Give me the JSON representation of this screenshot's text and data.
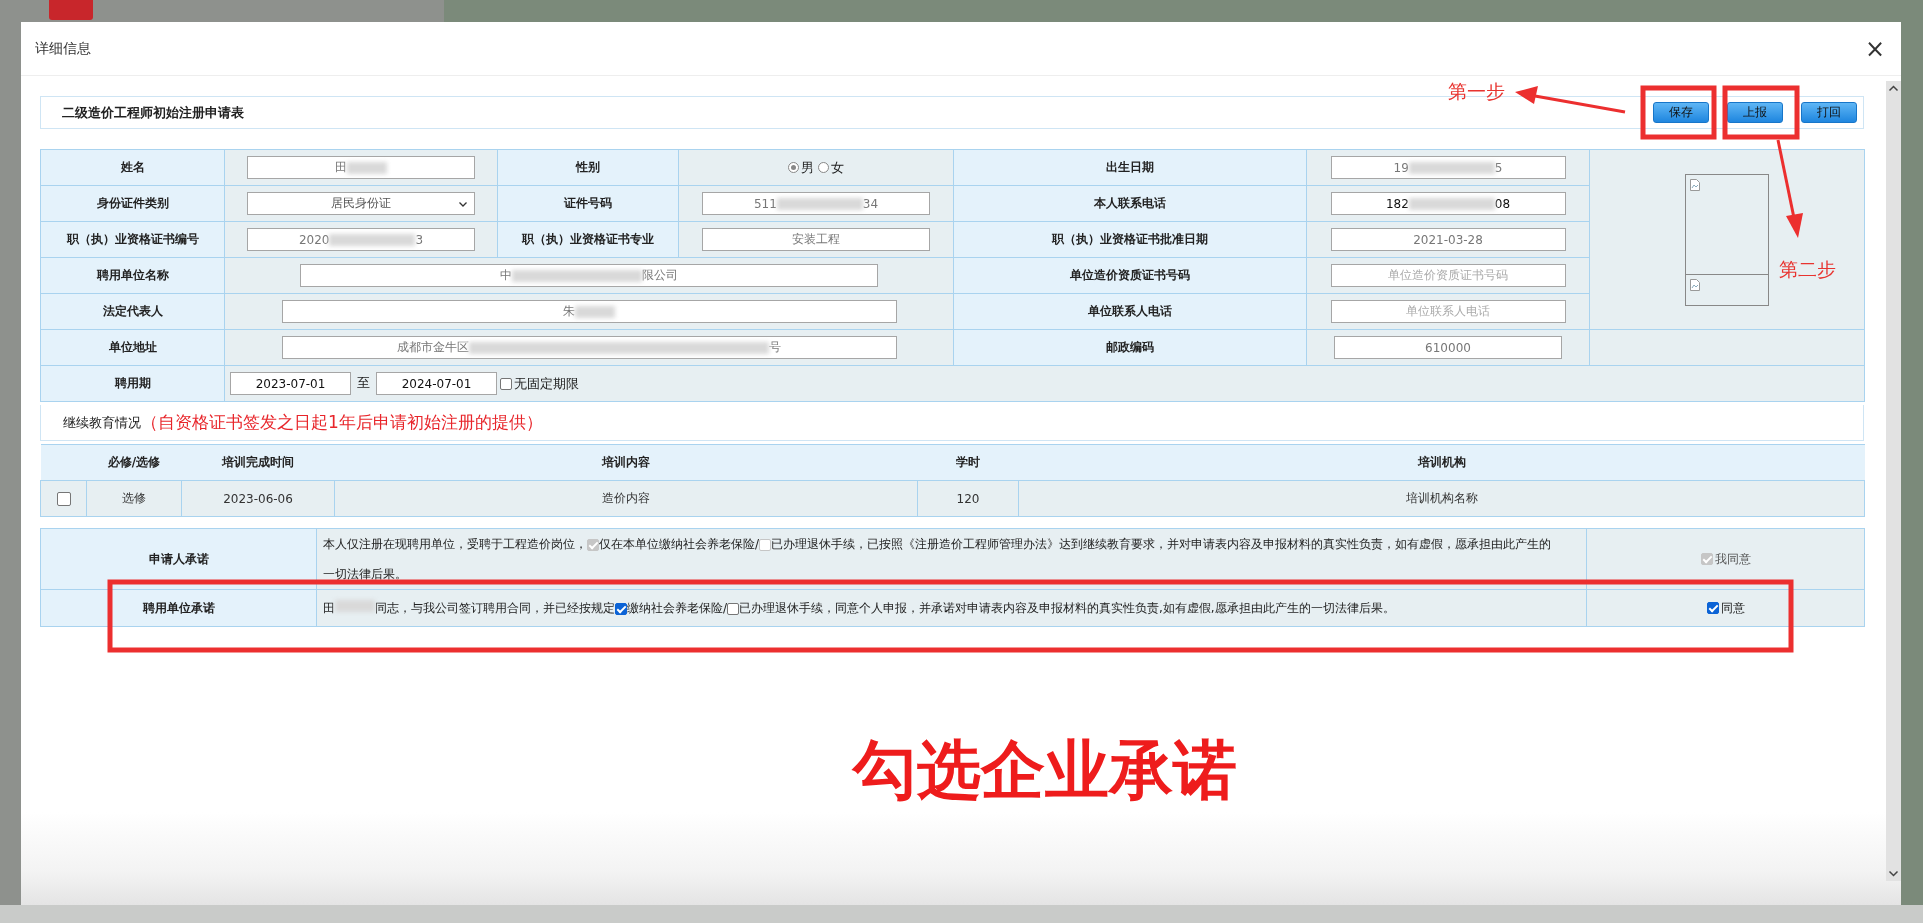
{
  "dialog": {
    "title": "详细信息",
    "close": "×"
  },
  "form": {
    "title": "二级造价工程师初始注册申请表",
    "buttons": [
      {
        "label": "保存"
      },
      {
        "label": "上报"
      },
      {
        "label": "打回"
      }
    ]
  },
  "fields": [
    {
      "cells": [
        {
          "label": "姓名",
          "kind": "masked",
          "prefix": "田",
          "editable": false
        },
        {
          "label": "性别",
          "kind": "radio",
          "options": [
            {
              "label": "男",
              "selected": true
            },
            {
              "label": "女",
              "selected": false
            }
          ]
        },
        {
          "label": "出生日期",
          "kind": "masked",
          "prefix": "19",
          "suffix": "5",
          "editable": false
        }
      ]
    },
    {
      "cells": [
        {
          "label": "身份证件类别",
          "kind": "select",
          "value": "居民身份证"
        },
        {
          "label": "证件号码",
          "kind": "masked",
          "prefix": "511",
          "suffix": "34",
          "editable": false
        },
        {
          "label": "本人联系电话",
          "kind": "masked",
          "prefix": "182",
          "suffix": "08",
          "editable": true
        }
      ]
    },
    {
      "cells": [
        {
          "label": "职（执）业资格证书编号",
          "kind": "masked",
          "prefix": "2020",
          "suffix": "3",
          "editable": false
        },
        {
          "label": "职（执）业资格证书专业",
          "kind": "text",
          "value": "安装工程",
          "editable": false
        },
        {
          "label": "职（执）业资格证书批准日期",
          "kind": "text",
          "value": "2021-03-28",
          "editable": false
        }
      ]
    },
    {
      "cells": [
        {
          "label": "聘用单位名称",
          "kind": "masked",
          "prefix": "中",
          "suffix": "限公司",
          "editable": false
        },
        {
          "label": "单位造价资质证书号码",
          "kind": "placeholder",
          "placeholder": "单位造价资质证书号码"
        }
      ]
    },
    {
      "cells": [
        {
          "label": "法定代表人",
          "kind": "masked",
          "prefix": "朱",
          "editable": false
        },
        {
          "label": "单位联系人电话",
          "kind": "placeholder",
          "placeholder": "单位联系人电话"
        }
      ]
    },
    {
      "cells": [
        {
          "label": "单位地址",
          "kind": "masked",
          "prefix": "成都市金牛区",
          "suffix": "号",
          "editable": false
        },
        {
          "label": "邮政编码",
          "kind": "text",
          "value": "610000",
          "editable": false
        }
      ]
    }
  ],
  "employment_period": {
    "label": "聘用期",
    "start": "2023-07-01",
    "separator": "至",
    "end": "2024-07-01",
    "open_ended": {
      "label": "无固定期限",
      "checked": false
    }
  },
  "education": {
    "title": "继续教育情况",
    "note": "（自资格证书签发之日起1年后申请初始注册的提供）",
    "columns": [
      "必修/选修",
      "培训完成时间",
      "培训内容",
      "学时",
      "培训机构"
    ],
    "rows": [
      {
        "checked": false,
        "cells": [
          "选修",
          "2023-06-06",
          "造价内容",
          "120",
          "培训机构名称"
        ]
      }
    ]
  },
  "commitments": [
    {
      "label": "申请人承诺",
      "segments": [
        {
          "kind": "text",
          "text": "本人仅注册在现聘用单位，受聘于工程造价岗位，"
        },
        {
          "kind": "check",
          "text": "仅在本单位缴纳社会养老保险/",
          "checked": true,
          "disabled": true
        },
        {
          "kind": "check",
          "text": "已办理退休手续，已按照《注册造价工程师管理办法》达到继续教育要求，并对申请表内容及申报材料的真实性负责，如有虚假，愿承担由此产生的",
          "checked": false,
          "disabled": true
        },
        {
          "kind": "text",
          "text": "一切法律后果。"
        }
      ],
      "agree": {
        "label": "我同意",
        "checked": true,
        "disabled": true
      }
    },
    {
      "label": "聘用单位承诺",
      "segments": [
        {
          "kind": "masked",
          "prefix": "田"
        },
        {
          "kind": "text",
          "text": "同志，与我公司签订聘用合同，并已经按规定"
        },
        {
          "kind": "check",
          "text": "缴纳社会养老保险/",
          "checked": true,
          "disabled": false
        },
        {
          "kind": "check",
          "text": "已办理退休手续，同意个人申报，并承诺对申请表内容及申报材料的真实性负责,如有虚假,愿承担由此产生的一切法律后果。",
          "checked": false,
          "disabled": false
        }
      ],
      "agree": {
        "label": "同意",
        "checked": true,
        "disabled": false
      }
    }
  ],
  "annotations": {
    "steps": [
      "第一步",
      "第二步"
    ],
    "caption": "勾选企业承诺"
  }
}
